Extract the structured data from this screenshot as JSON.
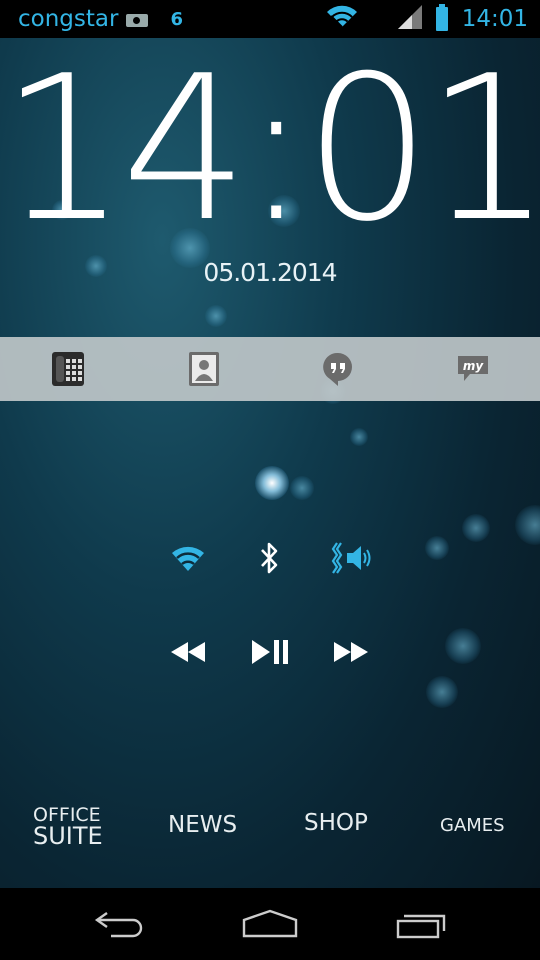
{
  "status_bar": {
    "carrier": "congstar",
    "network_indicator": "6",
    "time": "14:01",
    "icons": [
      "camera-icon",
      "wifi-icon",
      "signal-icon",
      "battery-icon"
    ]
  },
  "lockscreen": {
    "clock": "14:01",
    "date": "05.01.2014"
  },
  "dock": {
    "items": [
      {
        "icon": "phone-dialer-icon"
      },
      {
        "icon": "contacts-icon"
      },
      {
        "icon": "hangouts-icon"
      },
      {
        "icon": "my-app-icon",
        "text": "my"
      }
    ]
  },
  "quick_toggles": [
    {
      "icon": "wifi-icon"
    },
    {
      "icon": "bluetooth-icon"
    },
    {
      "icon": "vibrate-sound-icon"
    }
  ],
  "media_controls": [
    {
      "icon": "rewind-icon"
    },
    {
      "icon": "play-pause-icon"
    },
    {
      "icon": "fast-forward-icon"
    }
  ],
  "shortcuts": {
    "office_line1": "OFFICE",
    "office_line2": "SUITE",
    "news": "NEWS",
    "shop": "SHOP",
    "games": "GAMES"
  },
  "navigation": [
    {
      "icon": "back-icon"
    },
    {
      "icon": "home-icon"
    },
    {
      "icon": "recent-apps-icon"
    }
  ],
  "colors": {
    "accent": "#33b5e5",
    "background": "#0f3a4c",
    "dock": "#bec6c8"
  }
}
